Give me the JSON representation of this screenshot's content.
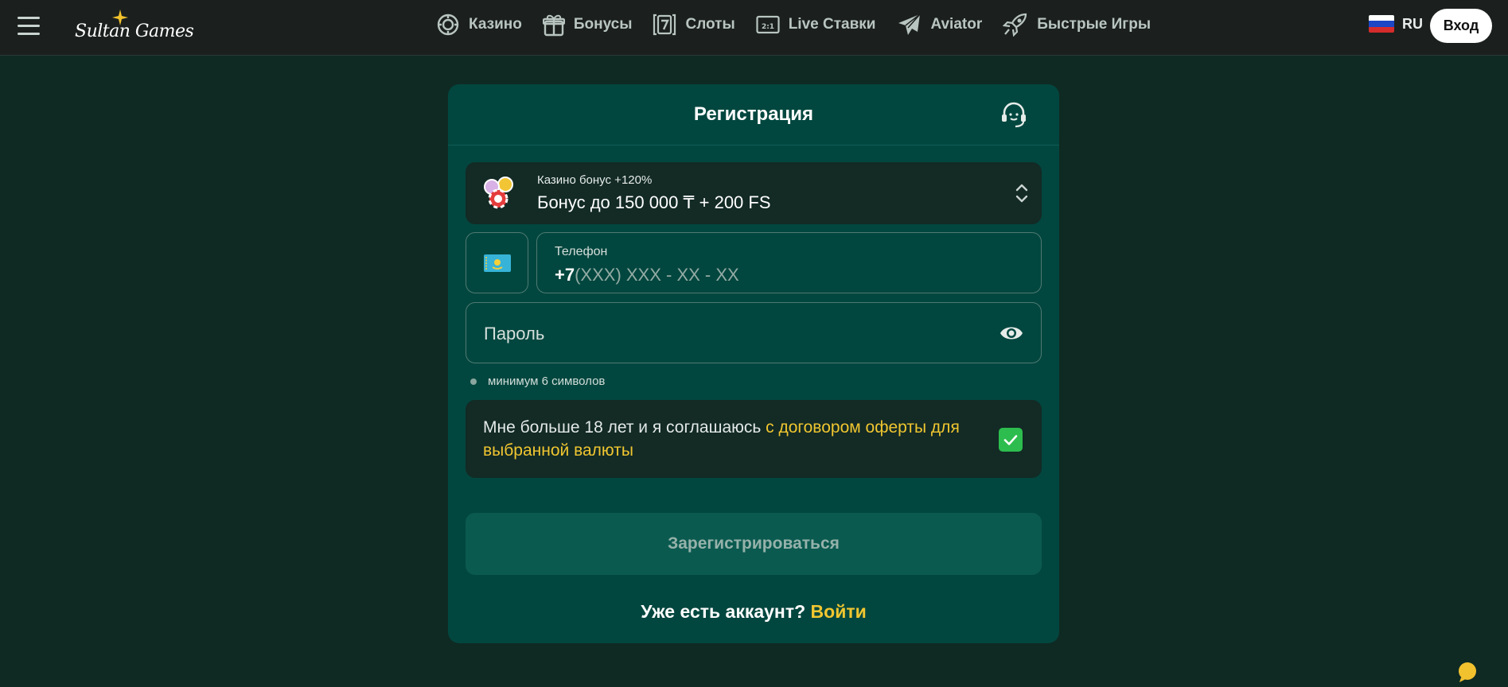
{
  "header": {
    "logo_text": "Sultan Games",
    "nav": [
      {
        "label": "Казино",
        "icon": "casino-chip-icon"
      },
      {
        "label": "Бонусы",
        "icon": "gift-icon"
      },
      {
        "label": "Слоты",
        "icon": "slot-seven-icon"
      },
      {
        "label": "Live Ставки",
        "icon": "live-score-icon"
      },
      {
        "label": "Aviator",
        "icon": "plane-icon"
      },
      {
        "label": "Быстрые Игры",
        "icon": "rocket-icon"
      }
    ],
    "language": "RU",
    "login_label": "Вход"
  },
  "registration": {
    "title": "Регистрация",
    "bonus": {
      "subtitle": "Казино бонус +120%",
      "title": "Бонус до 150 000 ₸ + 200 FS"
    },
    "phone": {
      "label": "Телефон",
      "prefix": "+7",
      "mask": "(XXX) XXX - XX - XX"
    },
    "password": {
      "placeholder": "Пароль"
    },
    "password_hint": "минимум 6 символов",
    "consent": {
      "text": "Мне больше 18 лет и я соглашаюсь ",
      "link": "с договором оферты для выбранной валюты",
      "checked": true
    },
    "submit_label": "Зарегистрироваться",
    "footer": {
      "question": "Уже есть аккаунт?",
      "link": "Войти"
    }
  },
  "colors": {
    "page_bg": "#0f2a23",
    "card_bg": "#02473f",
    "accent_yellow": "#f0c630",
    "checkbox_green": "#2dbd4e"
  }
}
